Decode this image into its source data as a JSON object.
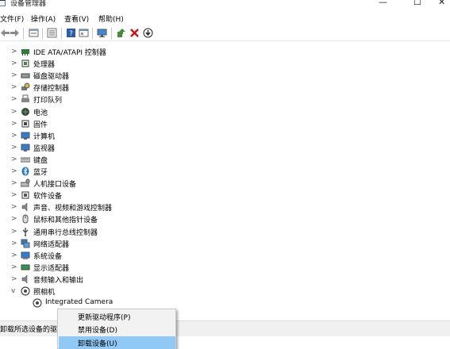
{
  "window": {
    "title": "设备管理器",
    "controls": [
      "—",
      "☐",
      "✕"
    ]
  },
  "menu": [
    "文件(F)",
    "操作(A)",
    "查看(V)",
    "帮助(H)"
  ],
  "toolbar": {
    "icons": [
      "back-icon",
      "forward-icon",
      "properties-icon",
      "list-view-icon",
      "help-icon",
      "details-view-icon",
      "monitor-icon",
      "update-driver-icon",
      "uninstall-icon",
      "scan-icon"
    ]
  },
  "tree": {
    "categories": [
      {
        "label": "IDE ATA/ATAPI 控制器",
        "chevron": ">",
        "icon": "ide-controller-icon",
        "color": "#2e7d32"
      },
      {
        "label": "处理器",
        "chevron": ">",
        "icon": "processor-icon",
        "color": "#3d8a3d"
      },
      {
        "label": "磁盘驱动器",
        "chevron": ">",
        "icon": "disk-drive-icon",
        "color": "#555555"
      },
      {
        "label": "存储控制器",
        "chevron": ">",
        "icon": "storage-controller-icon",
        "color": "#7a6a2a"
      },
      {
        "label": "打印队列",
        "chevron": ">",
        "icon": "print-queue-icon",
        "color": "#666666"
      },
      {
        "label": "电池",
        "chevron": ">",
        "icon": "battery-icon",
        "color": "#3a9a3a"
      },
      {
        "label": "固件",
        "chevron": ">",
        "icon": "firmware-icon",
        "color": "#444444"
      },
      {
        "label": "计算机",
        "chevron": ">",
        "icon": "computer-icon",
        "color": "#2a7fd4"
      },
      {
        "label": "监视器",
        "chevron": ">",
        "icon": "monitor-icon",
        "color": "#2a7fd4"
      },
      {
        "label": "键盘",
        "chevron": ">",
        "icon": "keyboard-icon",
        "color": "#777777"
      },
      {
        "label": "蓝牙",
        "chevron": ">",
        "icon": "bluetooth-icon",
        "color": "#1976d2"
      },
      {
        "label": "人机接口设备",
        "chevron": ">",
        "icon": "hid-icon",
        "color": "#666666"
      },
      {
        "label": "软件设备",
        "chevron": ">",
        "icon": "software-device-icon",
        "color": "#555555"
      },
      {
        "label": "声音、视频和游戏控制器",
        "chevron": ">",
        "icon": "sound-icon",
        "color": "#666666"
      },
      {
        "label": "鼠标和其他指针设备",
        "chevron": ">",
        "icon": "mouse-icon",
        "color": "#666666"
      },
      {
        "label": "通用串行总线控制器",
        "chevron": ">",
        "icon": "usb-icon",
        "color": "#444444"
      },
      {
        "label": "网络适配器",
        "chevron": ">",
        "icon": "network-adapter-icon",
        "color": "#2a7fd4"
      },
      {
        "label": "系统设备",
        "chevron": ">",
        "icon": "system-device-icon",
        "color": "#2a7fd4"
      },
      {
        "label": "显示适配器",
        "chevron": ">",
        "icon": "display-adapter-icon",
        "color": "#2a9a5a"
      },
      {
        "label": "音频输入和输出",
        "chevron": ">",
        "icon": "audio-io-icon",
        "color": "#666666"
      },
      {
        "label": "照相机",
        "chevron": "v",
        "icon": "camera-icon",
        "color": "#555555"
      }
    ],
    "child": {
      "label": "Integrated Camera",
      "icon": "camera-icon"
    }
  },
  "status_bar": {
    "text": "卸载所选设备的驱"
  },
  "context_menu": {
    "items": [
      {
        "label": "更新驱动程序(P)",
        "active": false
      },
      {
        "label": "禁用设备(D)",
        "active": false
      },
      {
        "label": "卸载设备(U)",
        "active": true
      }
    ],
    "highlight_color": "#90c8f6"
  }
}
